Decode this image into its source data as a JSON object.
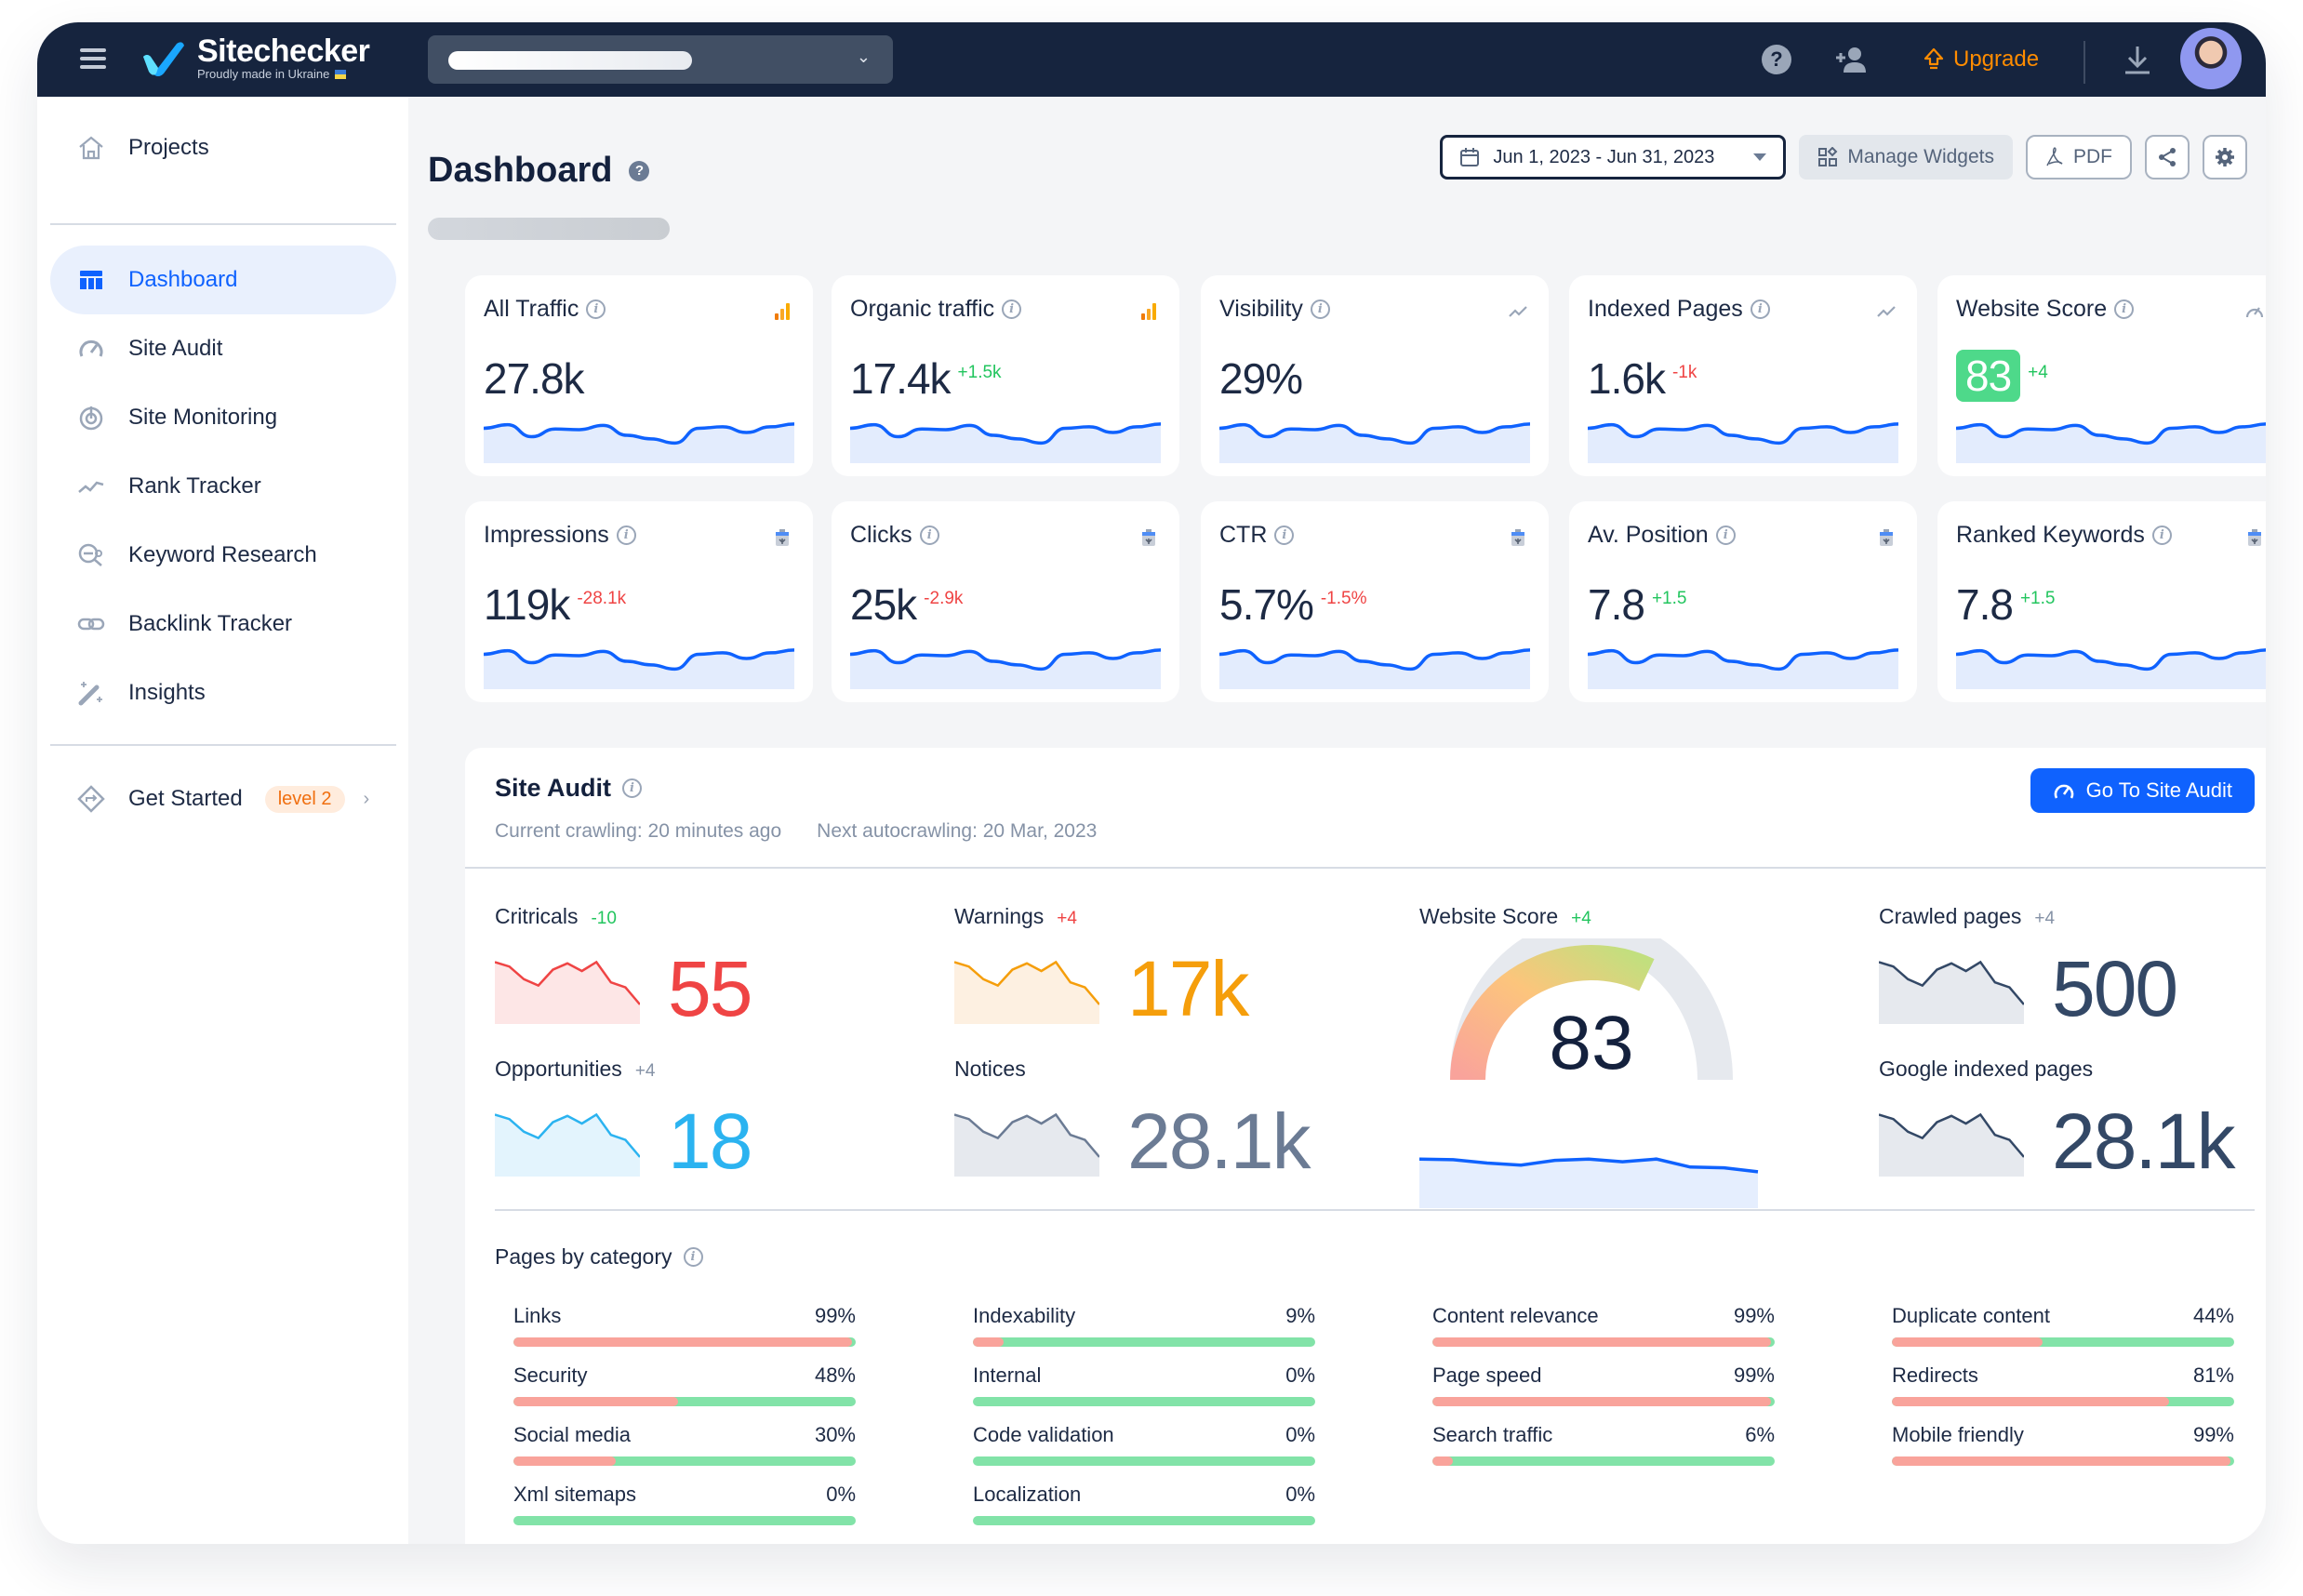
{
  "app": {
    "name": "Sitechecker",
    "tagline": "Proudly made in Ukraine",
    "upgrade_label": "Upgrade",
    "accent": "#0f62fe",
    "nav_bg": "#16243e",
    "upgrade_color": "#ff8c00"
  },
  "topbar": {
    "icons": [
      "menu-icon",
      "help-icon",
      "add-user-icon",
      "upgrade-icon",
      "download-icon",
      "avatar"
    ]
  },
  "sidebar": {
    "projects_label": "Projects",
    "items": [
      {
        "label": "Dashboard",
        "icon": "dashboard-icon",
        "active": true
      },
      {
        "label": "Site Audit",
        "icon": "gauge-icon"
      },
      {
        "label": "Site Monitoring",
        "icon": "monitoring-icon"
      },
      {
        "label": "Rank Tracker",
        "icon": "trend-icon"
      },
      {
        "label": "Keyword Research",
        "icon": "keyword-search-icon"
      },
      {
        "label": "Backlink Tracker",
        "icon": "link-icon"
      },
      {
        "label": "Insights",
        "icon": "magic-wand-icon"
      }
    ],
    "get_started": {
      "label": "Get Started",
      "badge": "level 2"
    }
  },
  "header": {
    "title": "Dashboard",
    "date_range": "Jun 1, 2023 - Jun 31, 2023",
    "manage_widgets": "Manage Widgets",
    "pdf": "PDF"
  },
  "cards": [
    {
      "title": "All Traffic",
      "value": "27.8k",
      "delta": "",
      "delta_type": "",
      "source": "analytics-icon"
    },
    {
      "title": "Organic traffic",
      "value": "17.4k",
      "delta": "+1.5k",
      "delta_type": "pos",
      "source": "analytics-icon"
    },
    {
      "title": "Visibility",
      "value": "29%",
      "delta": "",
      "delta_type": "",
      "source": "trend-icon"
    },
    {
      "title": "Indexed Pages",
      "value": "1.6k",
      "delta": "-1k",
      "delta_type": "neg",
      "source": "trend-icon"
    },
    {
      "title": "Website Score",
      "value": "83",
      "delta": "+4",
      "delta_type": "pos",
      "source": "gauge-icon",
      "badge": true
    },
    {
      "title": "Impressions",
      "value": "119k",
      "delta": "-28.1k",
      "delta_type": "neg",
      "source": "search-console-icon"
    },
    {
      "title": "Clicks",
      "value": "25k",
      "delta": "-2.9k",
      "delta_type": "neg",
      "source": "search-console-icon"
    },
    {
      "title": "CTR",
      "value": "5.7%",
      "delta": "-1.5%",
      "delta_type": "neg",
      "source": "search-console-icon"
    },
    {
      "title": "Av. Position",
      "value": "7.8",
      "delta": "+1.5",
      "delta_type": "pos",
      "source": "search-console-icon"
    },
    {
      "title": "Ranked Keywords",
      "value": "7.8",
      "delta": "+1.5",
      "delta_type": "pos",
      "source": "search-console-icon"
    }
  ],
  "sparkline": [
    0.62,
    0.72,
    0.38,
    0.6,
    0.58,
    0.7,
    0.42,
    0.32,
    0.2,
    0.62,
    0.66,
    0.5,
    0.66,
    0.74
  ],
  "site_audit": {
    "title": "Site Audit",
    "current_crawling": "Current crawling: 20 minutes ago",
    "next_autocrawling": "Next autocrawling: 20 Mar, 2023",
    "goto_label": "Go To Site Audit",
    "metrics": [
      {
        "label": "Critricals",
        "delta": "-10",
        "delta_color": "#22c55e",
        "value": "55",
        "color": "#ef4444",
        "fill": "#fde6e6"
      },
      {
        "label": "Warnings",
        "delta": "+4",
        "delta_color": "#ef4444",
        "value": "17k",
        "color": "#f59e0b",
        "fill": "#fdf0e1"
      },
      {
        "label": "Opportunities",
        "delta": "+4",
        "delta_color": "#8592a6",
        "value": "18",
        "color": "#2bb3f0",
        "fill": "#e3f4fd"
      },
      {
        "label": "Notices",
        "delta": "",
        "delta_color": "#8592a6",
        "value": "28.1k",
        "color": "#6b7b94",
        "fill": "#e6e9ee"
      },
      {
        "label": "Crawled pages",
        "delta": "+4",
        "delta_color": "#8592a6",
        "value": "500",
        "color": "#334866",
        "fill": "#e6e9ee"
      },
      {
        "label": "Google indexed pages",
        "delta": "",
        "delta_color": "#8592a6",
        "value": "28.1k",
        "color": "#334866",
        "fill": "#e6e9ee"
      }
    ],
    "mini_series": [
      0.92,
      0.85,
      0.65,
      0.55,
      0.8,
      0.9,
      0.78,
      0.92,
      0.6,
      0.52,
      0.25
    ],
    "website_score": {
      "label": "Website Score",
      "delta": "+4",
      "value": "83",
      "score_pct": 83
    },
    "score_series": [
      0.8,
      0.78,
      0.68,
      0.62,
      0.76,
      0.8,
      0.72,
      0.8,
      0.56,
      0.54,
      0.42
    ],
    "pages_by_category": {
      "title": "Pages by category",
      "columns": [
        [
          {
            "label": "Links",
            "pct": "99%",
            "value": 99
          },
          {
            "label": "Security",
            "pct": "48%",
            "value": 48
          },
          {
            "label": "Social media",
            "pct": "30%",
            "value": 30
          },
          {
            "label": "Xml sitemaps",
            "pct": "0%",
            "value": 0
          }
        ],
        [
          {
            "label": "Indexability",
            "pct": "9%",
            "value": 9
          },
          {
            "label": "Internal",
            "pct": "0%",
            "value": 0
          },
          {
            "label": "Code validation",
            "pct": "0%",
            "value": 0
          },
          {
            "label": "Localization",
            "pct": "0%",
            "value": 0
          }
        ],
        [
          {
            "label": "Content relevance",
            "pct": "99%",
            "value": 99
          },
          {
            "label": "Page speed",
            "pct": "99%",
            "value": 99
          },
          {
            "label": "Search traffic",
            "pct": "6%",
            "value": 6
          }
        ],
        [
          {
            "label": "Duplicate content",
            "pct": "44%",
            "value": 44
          },
          {
            "label": "Redirects",
            "pct": "81%",
            "value": 81
          },
          {
            "label": "Mobile friendly",
            "pct": "99%",
            "value": 99
          }
        ]
      ]
    }
  }
}
